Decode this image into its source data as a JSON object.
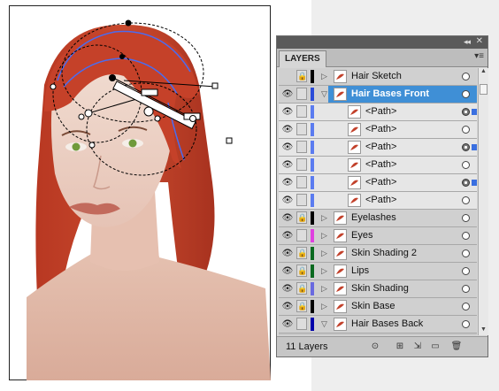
{
  "panel": {
    "tab_label": "LAYERS",
    "collapse_glyph": "◂◂",
    "close_glyph": "✕",
    "menu_glyph": "▾≡",
    "layer_count": "11 Layers"
  },
  "layers": [
    {
      "name": "Hair Sketch",
      "eye": false,
      "lock": true,
      "color": "#000000",
      "expanded": false,
      "sub": false,
      "selected": false,
      "target": "empty"
    },
    {
      "name": "Hair Bases Front",
      "eye": true,
      "lock": false,
      "color": "#2b4bd8",
      "expanded": true,
      "sub": false,
      "selected": true,
      "target": "empty"
    },
    {
      "name": "<Path>",
      "eye": true,
      "lock": false,
      "color": "#5b7cf0",
      "expanded": false,
      "sub": true,
      "selected": false,
      "target": "filled",
      "selsq": true
    },
    {
      "name": "<Path>",
      "eye": true,
      "lock": false,
      "color": "#5b7cf0",
      "expanded": false,
      "sub": true,
      "selected": false,
      "target": "empty"
    },
    {
      "name": "<Path>",
      "eye": true,
      "lock": false,
      "color": "#5b7cf0",
      "expanded": false,
      "sub": true,
      "selected": false,
      "target": "filled",
      "selsq": true
    },
    {
      "name": "<Path>",
      "eye": true,
      "lock": false,
      "color": "#5b7cf0",
      "expanded": false,
      "sub": true,
      "selected": false,
      "target": "empty"
    },
    {
      "name": "<Path>",
      "eye": true,
      "lock": false,
      "color": "#5b7cf0",
      "expanded": false,
      "sub": true,
      "selected": false,
      "target": "filled",
      "selsq": true
    },
    {
      "name": "<Path>",
      "eye": true,
      "lock": false,
      "color": "#5b7cf0",
      "expanded": false,
      "sub": true,
      "selected": false,
      "target": "empty"
    },
    {
      "name": "Eyelashes",
      "eye": true,
      "lock": true,
      "color": "#000000",
      "expanded": false,
      "sub": false,
      "selected": false,
      "target": "empty"
    },
    {
      "name": "Eyes",
      "eye": true,
      "lock": false,
      "color": "#e040e0",
      "expanded": false,
      "sub": false,
      "selected": false,
      "target": "empty"
    },
    {
      "name": "Skin Shading 2",
      "eye": true,
      "lock": true,
      "color": "#0a6a20",
      "expanded": false,
      "sub": false,
      "selected": false,
      "target": "empty"
    },
    {
      "name": "Lips",
      "eye": true,
      "lock": true,
      "color": "#0a6a20",
      "expanded": false,
      "sub": false,
      "selected": false,
      "target": "empty"
    },
    {
      "name": "Skin Shading",
      "eye": true,
      "lock": true,
      "color": "#6a6ae0",
      "expanded": false,
      "sub": false,
      "selected": false,
      "target": "empty"
    },
    {
      "name": "Skin Base",
      "eye": true,
      "lock": true,
      "color": "#000000",
      "expanded": false,
      "sub": false,
      "selected": false,
      "target": "empty"
    },
    {
      "name": "Hair Bases Back",
      "eye": true,
      "lock": false,
      "color": "#0000aa",
      "expanded": true,
      "sub": false,
      "selected": false,
      "target": "empty"
    }
  ],
  "icons": {
    "eye": "eye-icon",
    "lock": "lock-icon",
    "expand": "disclosure-triangle-icon",
    "target": "target-circle-icon"
  },
  "colors": {
    "hair": "#c2402a",
    "selection": "#3f8fd6",
    "path_anchor": "#4a6cf0"
  }
}
